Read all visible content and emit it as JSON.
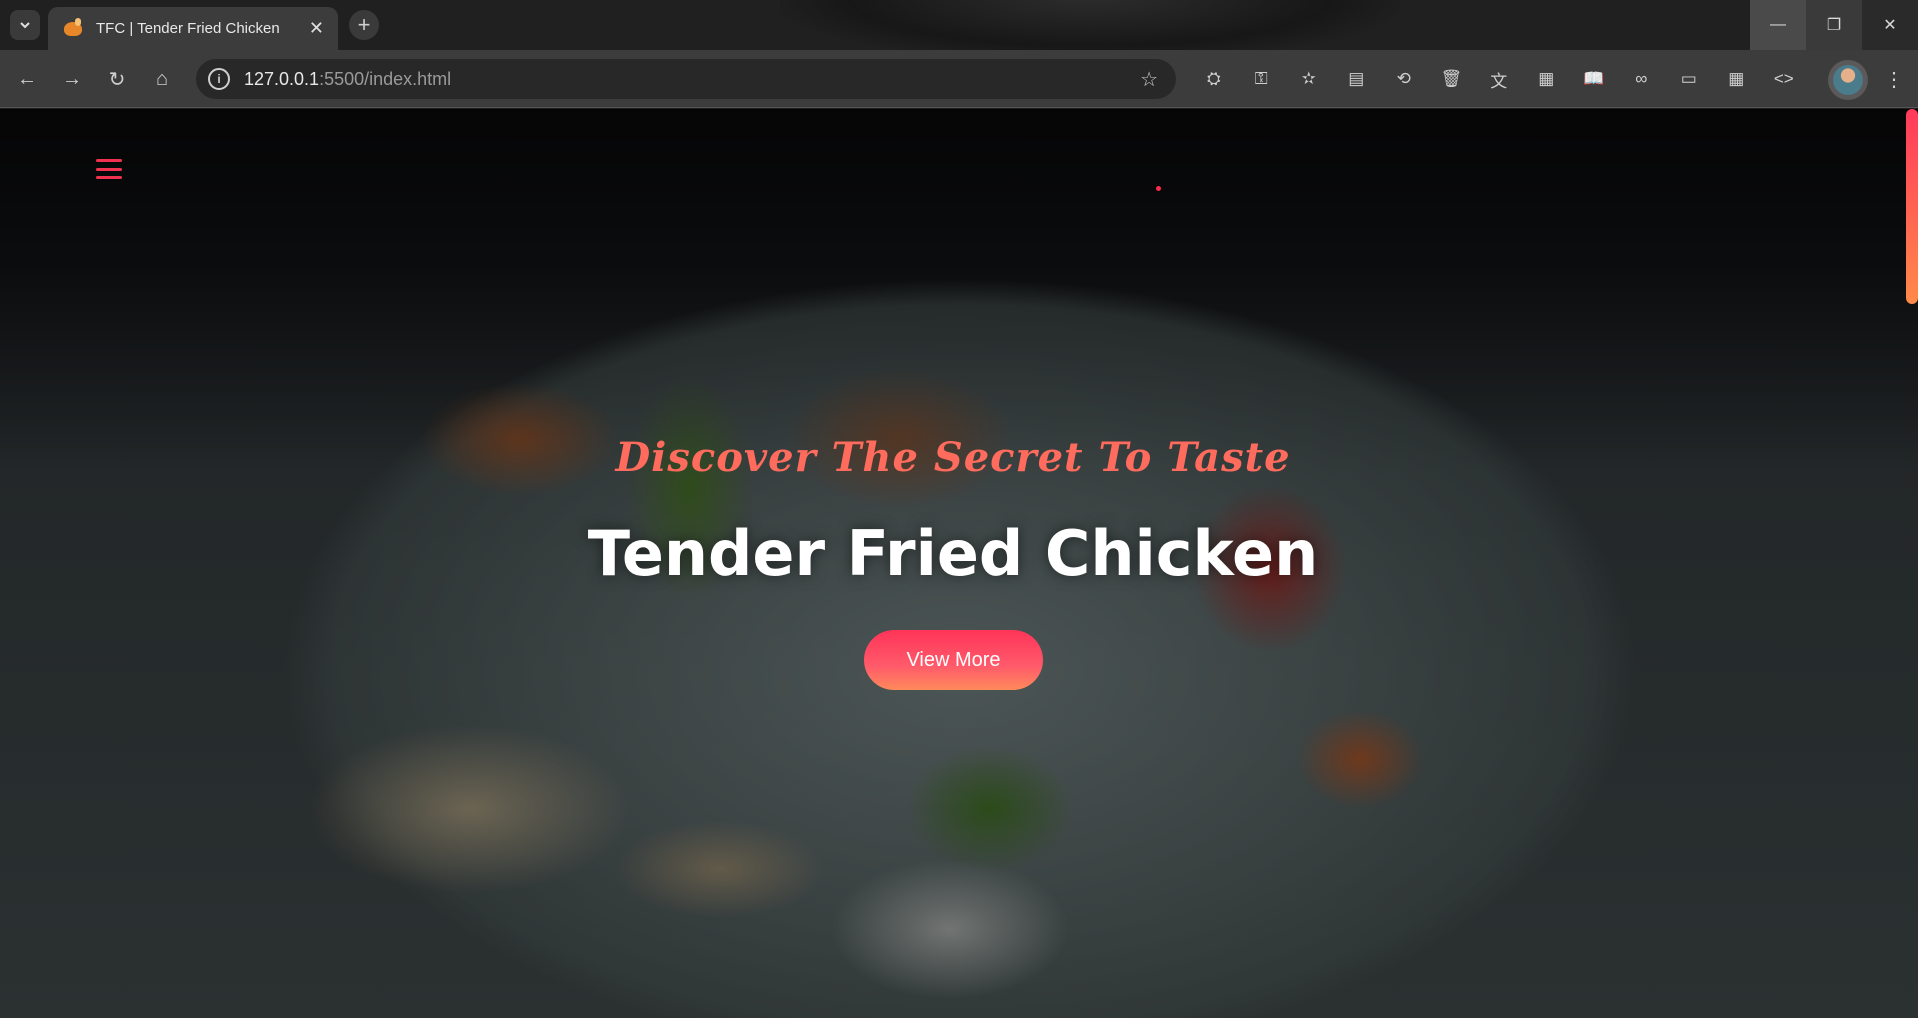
{
  "browser": {
    "tab": {
      "title": "TFC | Tender Fried Chicken",
      "close_glyph": "✕"
    },
    "new_tab_glyph": "+",
    "window_controls": {
      "minimize_glyph": "—",
      "maximize_glyph": "❐",
      "close_glyph": "✕"
    },
    "address_bar": {
      "host": "127.0.0.1",
      "path": ":5500/index.html"
    },
    "nav": {
      "back_glyph": "←",
      "forward_glyph": "→",
      "reload_glyph": "↻",
      "home_glyph": "⌂"
    },
    "bookmark_glyph": "☆",
    "menu_glyph": "⋮",
    "extensions": [
      {
        "icon": "incognito-icon",
        "glyph": "⛭"
      },
      {
        "icon": "key-icon",
        "glyph": "⚿"
      },
      {
        "icon": "favorites-icon",
        "glyph": "✫"
      },
      {
        "icon": "reading-list-icon",
        "glyph": "▤"
      },
      {
        "icon": "history-icon",
        "glyph": "⟲"
      },
      {
        "icon": "delete-icon",
        "glyph": "🗑"
      },
      {
        "icon": "translate-icon",
        "glyph": "文"
      },
      {
        "icon": "qr-code-icon",
        "glyph": "▦"
      },
      {
        "icon": "reader-mode-icon",
        "glyph": "📖"
      },
      {
        "icon": "link-icon",
        "glyph": "∞"
      },
      {
        "icon": "devices-icon",
        "glyph": "▭"
      },
      {
        "icon": "table-icon",
        "glyph": "▦"
      },
      {
        "icon": "code-icon",
        "glyph": "<>"
      }
    ]
  },
  "page": {
    "tagline": "Discover The Secret To Taste",
    "title": "Tender Fried Chicken",
    "cta_label": "View More"
  },
  "colors": {
    "accent": "#f0314f",
    "tagline": "#ff6b5c",
    "cta_gradient_start": "#ff3458",
    "cta_gradient_end": "#ff8a5b"
  }
}
